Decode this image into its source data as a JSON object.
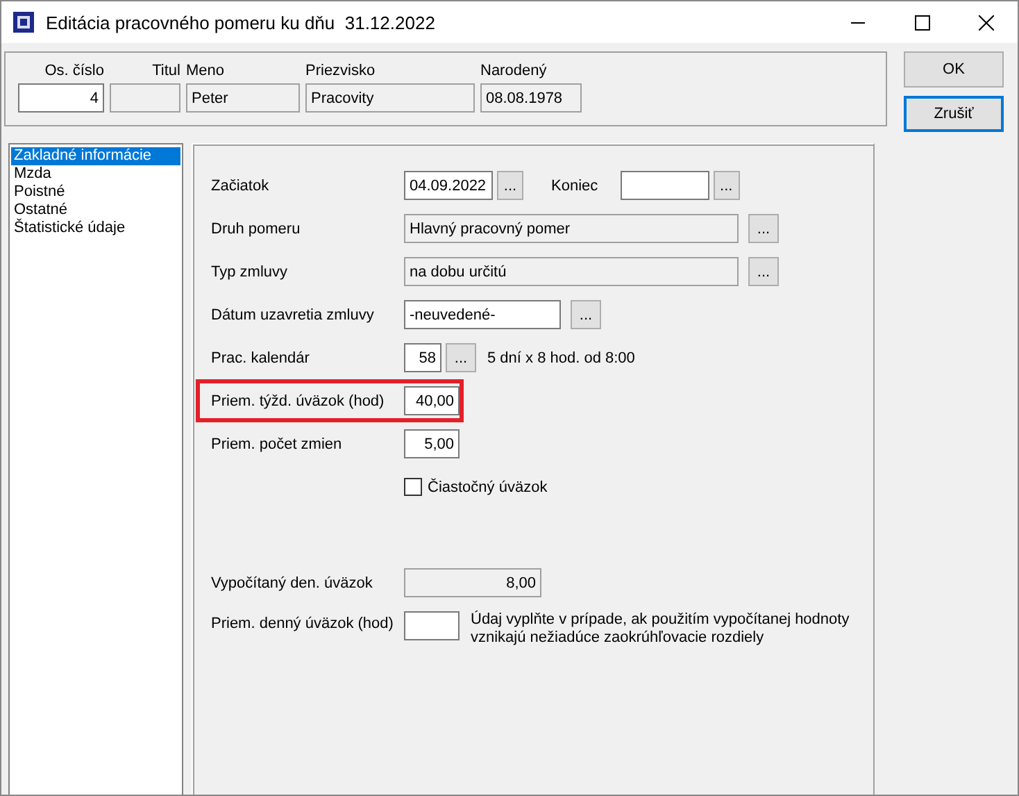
{
  "window": {
    "title": "Editácia pracovného pomeru ku dňu  31.12.2022"
  },
  "header": [
    {
      "label": "Os. číslo",
      "value": "4",
      "readonly": false
    },
    {
      "label": "Titul",
      "readonly": true
    },
    {
      "label": "Meno",
      "value": "Peter",
      "readonly": true
    },
    {
      "label": "Priezvisko",
      "value": "Pracovity",
      "readonly": true
    },
    {
      "label": "Narodený",
      "value": "08.08.1978",
      "readonly": true
    }
  ],
  "buttons": [
    {
      "label": "OK",
      "default": false
    },
    {
      "label": "Zrušiť",
      "default": true
    }
  ],
  "sidebar": {
    "items": [
      {
        "label": "Zakladné informácie",
        "selected": true
      },
      {
        "label": "Mzda",
        "selected": false
      },
      {
        "label": "Poistné",
        "selected": false
      },
      {
        "label": "Ostatné",
        "selected": false
      },
      {
        "label": "Štatistické údaje",
        "selected": false
      }
    ]
  },
  "form": {
    "rows": [
      {
        "kind": "range",
        "label": "Začiatok",
        "value": "04.09.2022",
        "browse": "...",
        "end_label": "Koniec",
        "end_browse": "..."
      },
      {
        "kind": "lookup",
        "label": "Druh pomeru",
        "value": "Hlavný pracovný pomer",
        "browse": "..."
      },
      {
        "kind": "lookup",
        "label": "Typ zmluvy",
        "value": "na dobu určitú",
        "browse": "..."
      },
      {
        "kind": "date",
        "label": "Dátum uzavretia zmluvy",
        "value": "-neuvedené-",
        "browse": "..."
      },
      {
        "kind": "calendar",
        "label": "Prac. kalendár",
        "value": "58",
        "browse": "...",
        "note": "5 dní x 8 hod. od 8:00"
      },
      {
        "kind": "number",
        "label": "Priem. týžd. úväzok (hod)",
        "value": "40,00",
        "highlighted": true
      },
      {
        "kind": "number",
        "label": "Priem. počet zmien",
        "value": "5,00",
        "highlighted": false
      },
      {
        "kind": "checkbox",
        "label": "Čiastočný úväzok",
        "checked": false
      },
      {
        "kind": "gap"
      },
      {
        "kind": "computed",
        "label": "Vypočítaný den. úväzok",
        "value": "8,00"
      },
      {
        "kind": "hint",
        "label": "Priem. denný úväzok (hod)",
        "note": "Údaj vyplňte v prípade, ak použitím vypočítanej hodnoty vznikajú nežiadúce zaokrúhľovacie rozdiely"
      }
    ]
  }
}
